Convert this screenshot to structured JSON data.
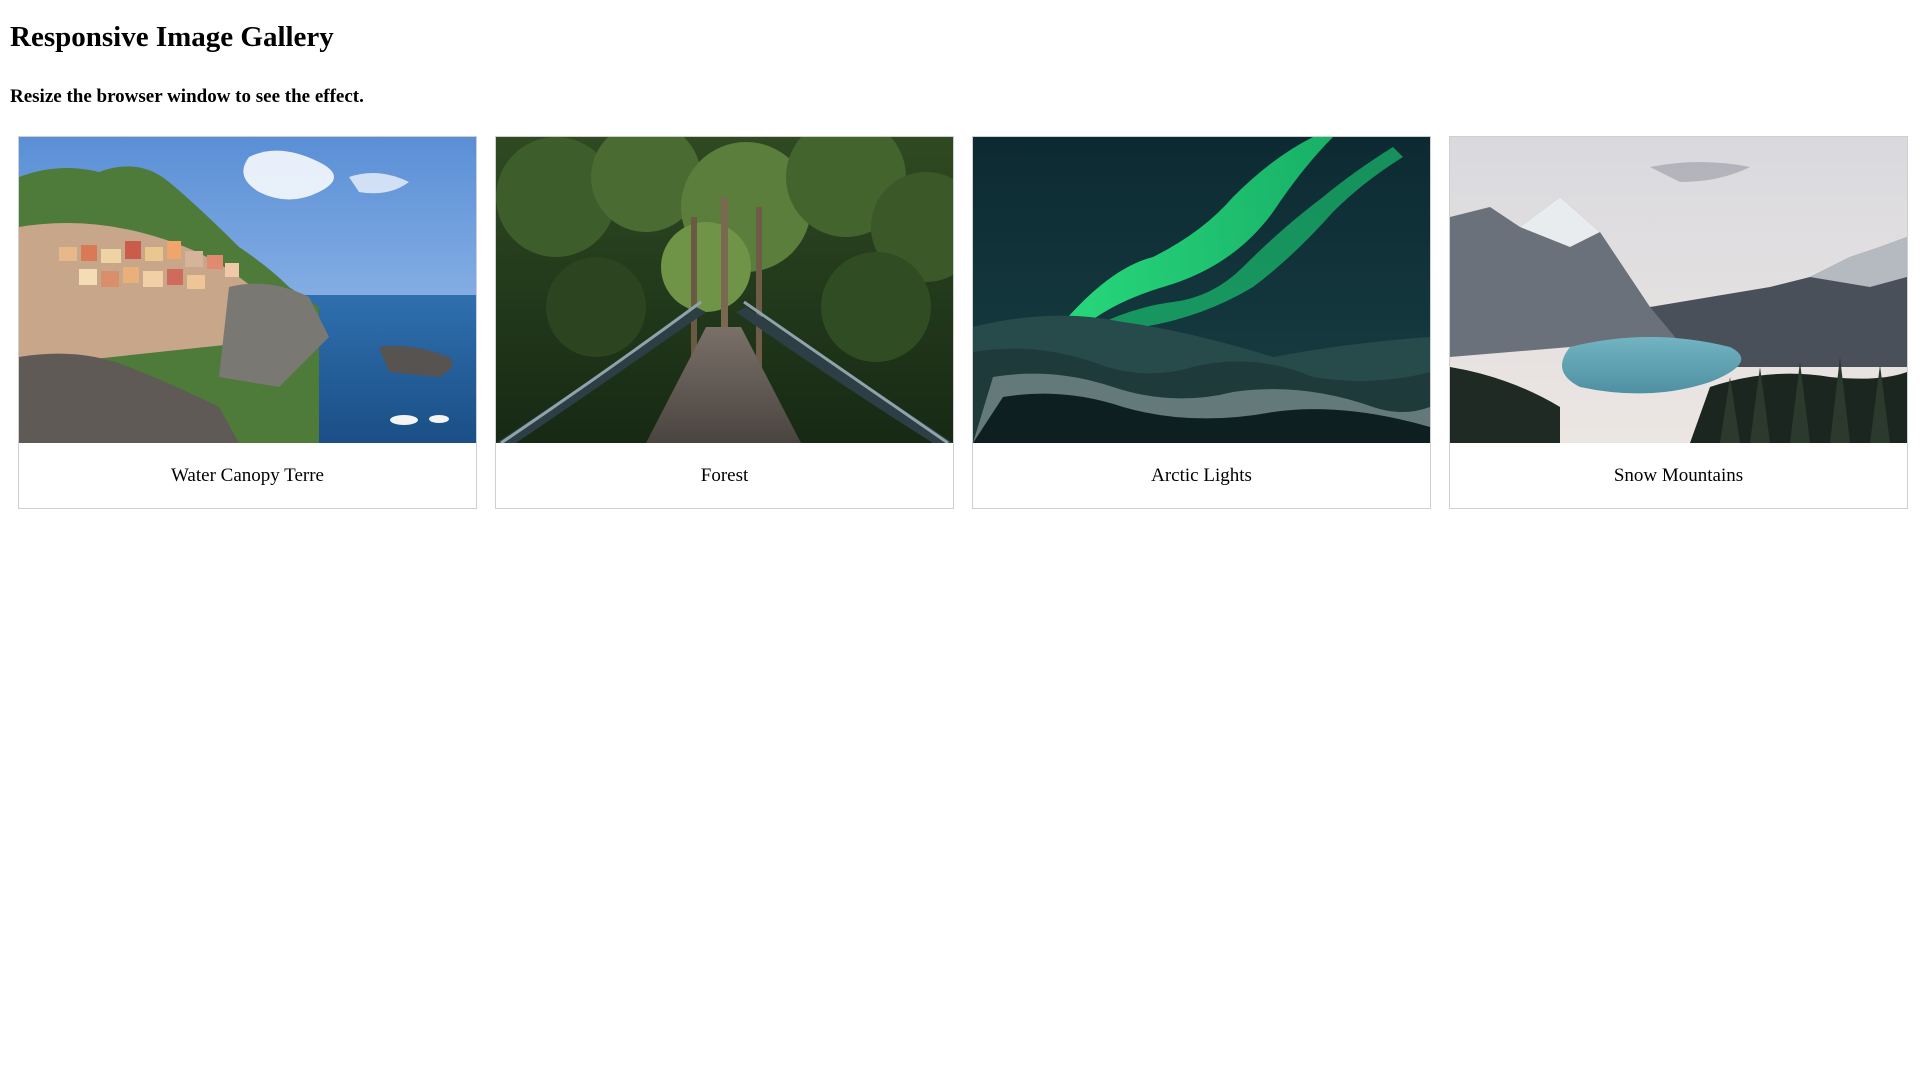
{
  "page": {
    "title": "Responsive Image Gallery",
    "subtitle": "Resize the browser window to see the effect."
  },
  "gallery": {
    "items": [
      {
        "caption": "Water Canopy Terre",
        "image": "coastal-village-cliff-photo"
      },
      {
        "caption": "Forest",
        "image": "forest-bridge-photo"
      },
      {
        "caption": "Arctic Lights",
        "image": "aurora-mountains-photo"
      },
      {
        "caption": "Snow Mountains",
        "image": "mountain-lake-photo"
      }
    ]
  }
}
